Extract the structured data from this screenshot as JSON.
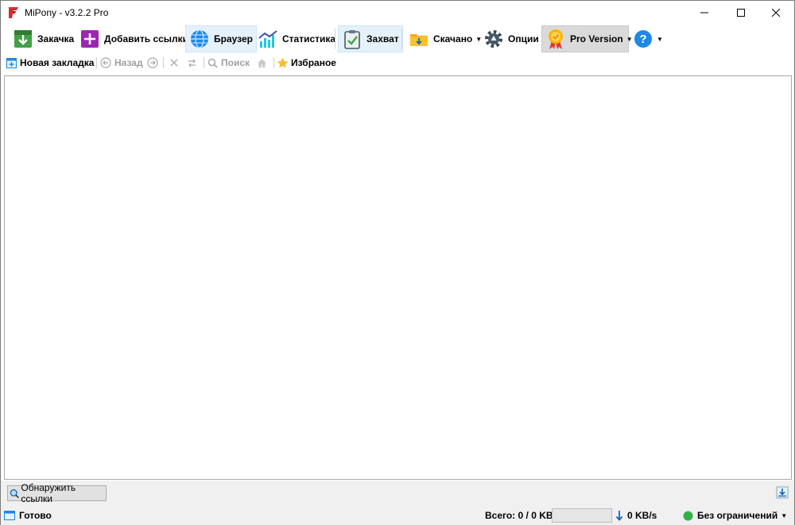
{
  "window": {
    "title": "MiPony - v3.2.2 Pro"
  },
  "toolbar": {
    "download": "Закачка",
    "add_links": "Добавить ссылки",
    "browser": "Браузер",
    "statistics": "Статистика",
    "capture": "Захват",
    "downloaded": "Скачано",
    "options": "Опции",
    "pro_version": "Pro Version"
  },
  "nav": {
    "new_tab": "Новая закладка",
    "back": "Назад",
    "search": "Поиск",
    "favorites": "Избраное"
  },
  "bottom": {
    "detect_links": "Обнаружить ссылки"
  },
  "status": {
    "state": "Готово",
    "total": "Всего: 0 / 0 KB",
    "speed": "0 KB/s",
    "limit": "Без ограничений",
    "progress_fraction": 0
  },
  "colors": {
    "active_tab_bg": "#e5f1fb",
    "pro_bg": "#dadada",
    "status_ok": "#2fb24a",
    "help_blue": "#1e88e5"
  }
}
